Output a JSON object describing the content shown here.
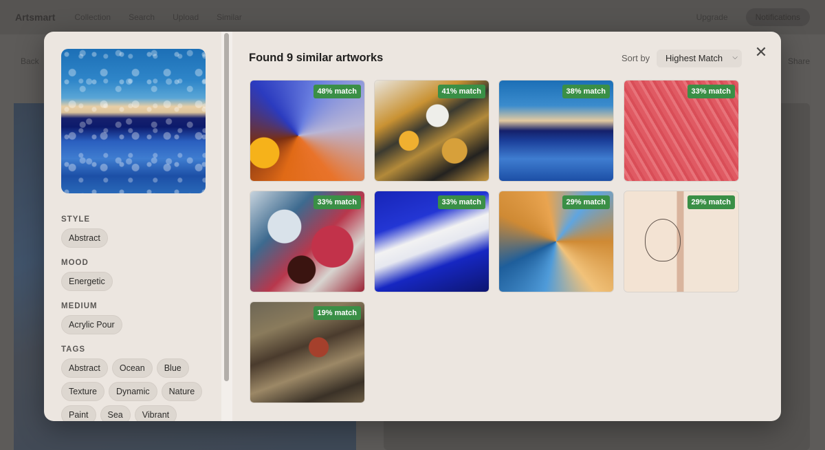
{
  "background": {
    "logo": "Artsmart",
    "nav": [
      "Collection",
      "Search",
      "Upload",
      "Similar"
    ],
    "right_items": [
      "Upgrade",
      "Notifications"
    ],
    "back_label": "Back",
    "right_text": "Share"
  },
  "modal": {
    "left": {
      "sections": [
        {
          "label": "STYLE",
          "chips": [
            "Abstract"
          ]
        },
        {
          "label": "MOOD",
          "chips": [
            "Energetic"
          ]
        },
        {
          "label": "MEDIUM",
          "chips": [
            "Acrylic Pour"
          ]
        },
        {
          "label": "TAGS",
          "chips": [
            "Abstract",
            "Ocean",
            "Blue",
            "Texture",
            "Dynamic",
            "Nature",
            "Paint",
            "Sea",
            "Vibrant"
          ]
        }
      ]
    },
    "right": {
      "title": "Found 9 similar artworks",
      "sort_label": "Sort by",
      "sort_value": "Highest Match",
      "close_icon": "close-icon",
      "results": [
        {
          "match": "48% match"
        },
        {
          "match": "41% match"
        },
        {
          "match": "38% match"
        },
        {
          "match": "33% match"
        },
        {
          "match": "33% match"
        },
        {
          "match": "33% match"
        },
        {
          "match": "29% match"
        },
        {
          "match": "29% match"
        },
        {
          "match": "19% match"
        }
      ]
    }
  },
  "colors": {
    "badge": "#3a8f46",
    "modal_bg": "#ece6e0",
    "chip_bg": "#ddd7d0"
  }
}
